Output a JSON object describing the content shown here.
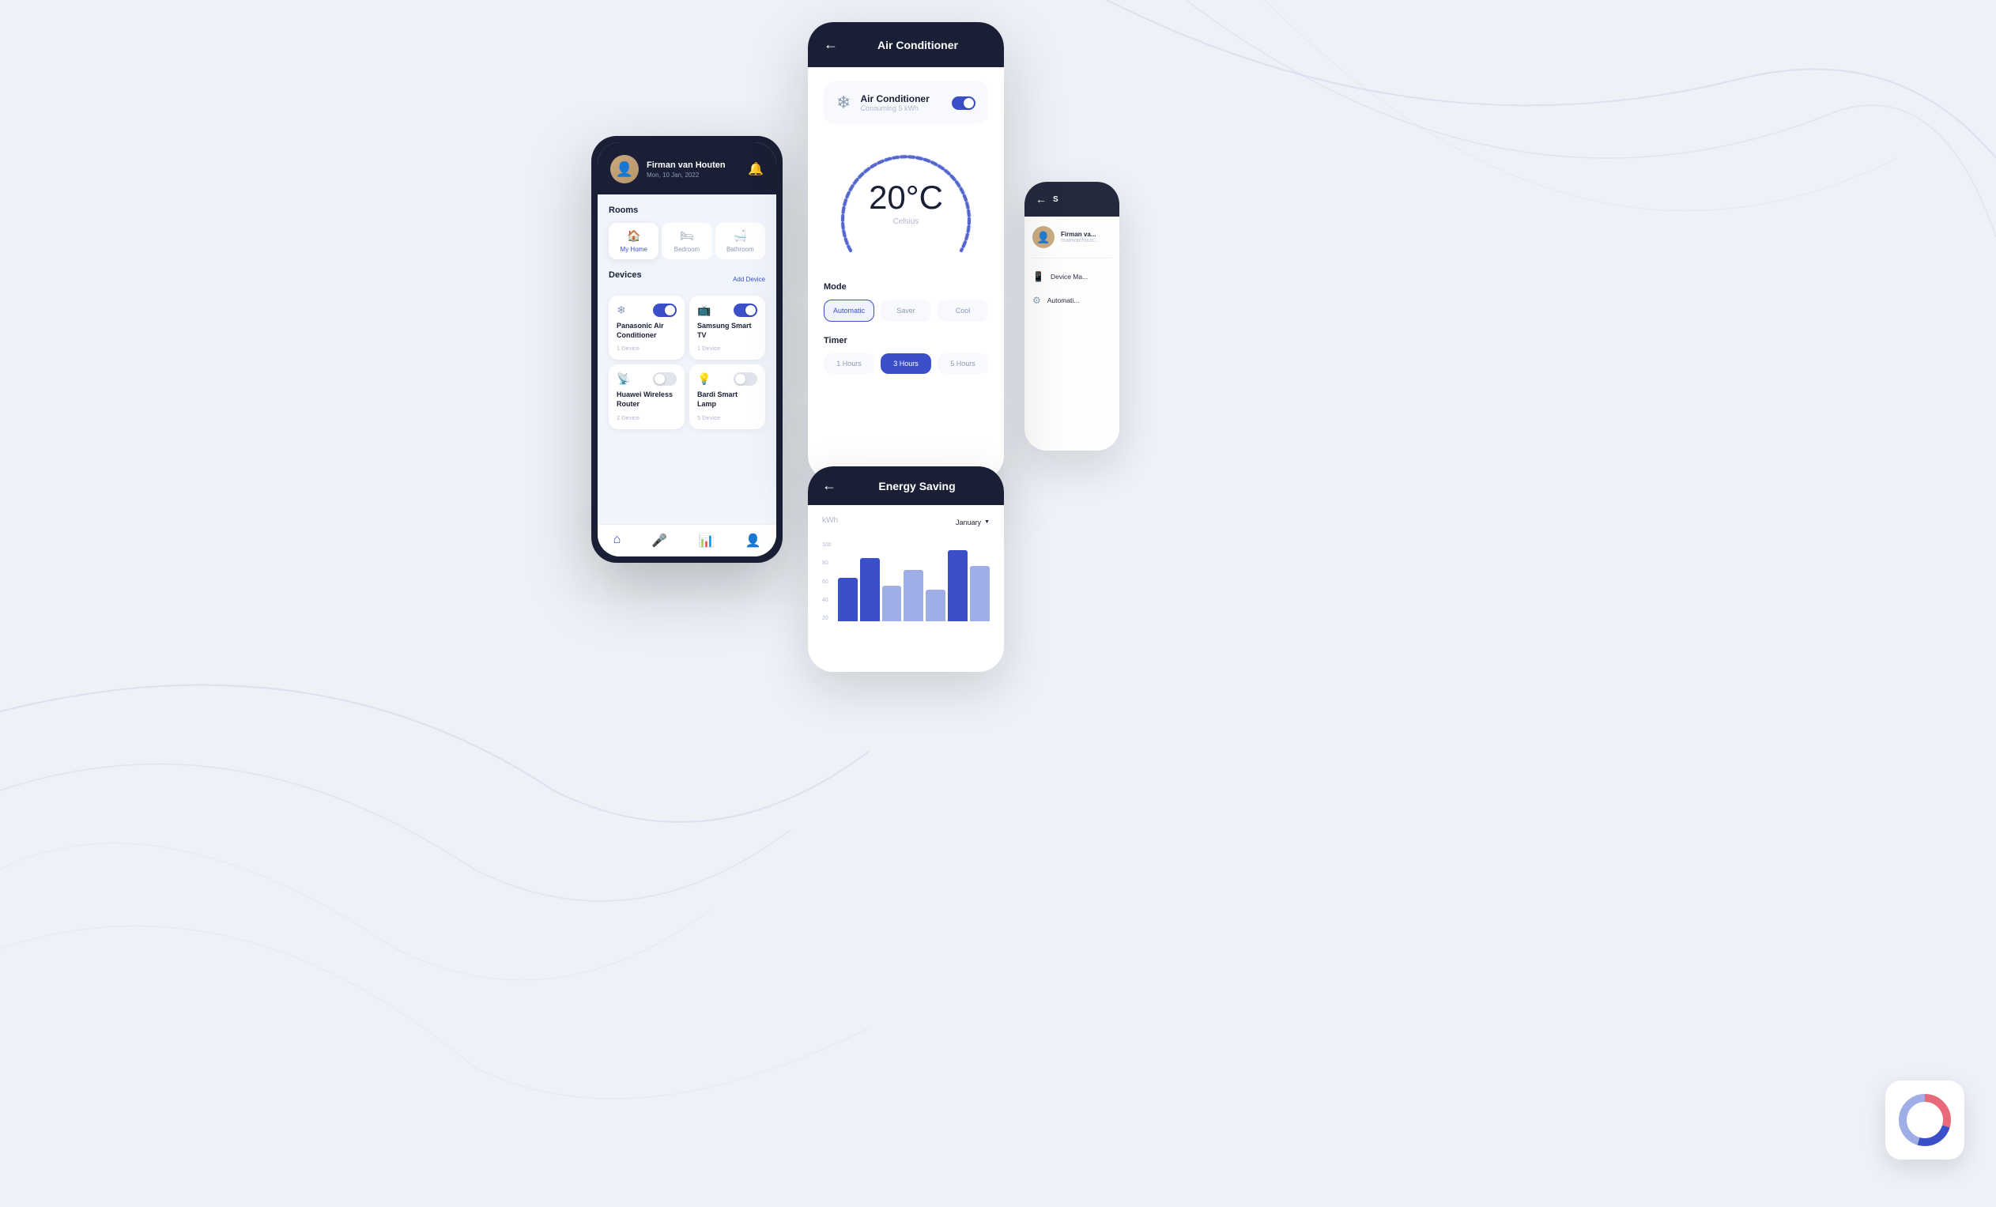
{
  "background": {
    "color": "#eef2f8"
  },
  "main_phone": {
    "header": {
      "user_name": "Firman van Houten",
      "date": "Mon, 10 Jan, 2022",
      "bell_icon": "bell"
    },
    "rooms": {
      "section_title": "Rooms",
      "tabs": [
        {
          "id": "my-home",
          "label": "My Home",
          "icon": "🏠",
          "active": true
        },
        {
          "id": "bedroom",
          "label": "Bedroom",
          "icon": "🛏",
          "active": false
        },
        {
          "id": "bathroom",
          "label": "Bathroom",
          "icon": "🛁",
          "active": false
        }
      ]
    },
    "devices": {
      "section_title": "Devices",
      "add_label": "Add Device",
      "items": [
        {
          "id": "ac",
          "name": "Panasonic Air Conditioner",
          "count": "1 Device",
          "icon": "❄",
          "on": true
        },
        {
          "id": "tv",
          "name": "Samsung Smart TV",
          "count": "1 Device",
          "icon": "📺",
          "on": true
        },
        {
          "id": "router",
          "name": "Huawei Wireless Router",
          "count": "2 Device",
          "icon": "📡",
          "on": false
        },
        {
          "id": "lamp",
          "name": "Bardi Smart Lamp",
          "count": "5 Device",
          "icon": "💡",
          "on": false
        }
      ]
    },
    "bottom_nav": [
      {
        "id": "home",
        "icon": "⌂",
        "active": true
      },
      {
        "id": "mic",
        "icon": "🎤",
        "active": false
      },
      {
        "id": "stats",
        "icon": "📊",
        "active": false
      },
      {
        "id": "user",
        "icon": "👤",
        "active": false
      }
    ]
  },
  "ac_panel": {
    "title": "Air Conditioner",
    "back_icon": "←",
    "device": {
      "name": "Air Conditioner",
      "sub": "Consuming 5 kWh",
      "icon": "❄",
      "toggle_on": true
    },
    "temperature": {
      "value": "20°C",
      "unit": "Celsius"
    },
    "mode": {
      "label": "Mode",
      "options": [
        {
          "id": "automatic",
          "label": "Automatic",
          "active": true
        },
        {
          "id": "saver",
          "label": "Saver",
          "active": false
        },
        {
          "id": "cool",
          "label": "Cool",
          "active": false
        }
      ]
    },
    "timer": {
      "label": "Timer",
      "options": [
        {
          "id": "1h",
          "label": "1 Hours",
          "active": false
        },
        {
          "id": "3h",
          "label": "3 Hours",
          "active": true
        },
        {
          "id": "5h",
          "label": "5 Hours",
          "active": false
        }
      ]
    }
  },
  "energy_panel": {
    "title": "Energy Saving",
    "back_icon": "←",
    "kwh_label": "kWh",
    "month_label": "January",
    "chart": {
      "y_labels": [
        "100",
        "80",
        "60",
        "40",
        "20"
      ],
      "bars": [
        {
          "height": 55,
          "color": "#3b4fc8"
        },
        {
          "height": 80,
          "color": "#3b4fc8"
        },
        {
          "height": 45,
          "color": "#a0aee8"
        },
        {
          "height": 65,
          "color": "#a0aee8"
        },
        {
          "height": 40,
          "color": "#a0aee8"
        },
        {
          "height": 90,
          "color": "#3b4fc8"
        },
        {
          "height": 70,
          "color": "#a0aee8"
        }
      ]
    }
  },
  "right_panel": {
    "back_icon": "←",
    "user_name": "Firman va...",
    "user_sub": "mainvanhous...",
    "menu_items": [
      {
        "id": "device-ma",
        "icon": "📱",
        "label": "Device Ma..."
      },
      {
        "id": "automatic",
        "icon": "⚙",
        "label": "Automati..."
      }
    ]
  }
}
